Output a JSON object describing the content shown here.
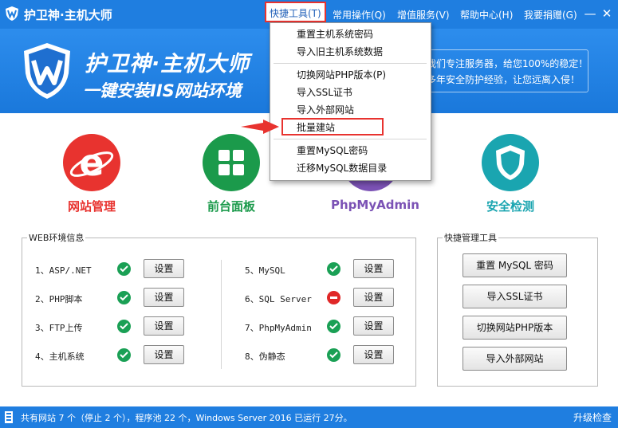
{
  "app": {
    "title": "护卫神·主机大师"
  },
  "menu": {
    "quick_tools": "快捷工具(T)",
    "common_ops": "常用操作(Q)",
    "value_added": "增值服务(V)",
    "help": "帮助中心(H)",
    "donate": "我要捐赠(G)"
  },
  "window_controls": {
    "minimize": "—",
    "close": "✕"
  },
  "banner": {
    "name": "护卫神·主机大师",
    "subtitle": "一键安装IIS网站环境",
    "slogan1": "我们专注服务器，给您100%的稳定！",
    "slogan2": "多年安全防护经验，让您远离入侵！"
  },
  "features": [
    {
      "label": "网站管理",
      "color": "#e8332f",
      "icon": "ie-icon"
    },
    {
      "label": "前台面板",
      "color": "#1b9a4b",
      "icon": "grid-icon"
    },
    {
      "label": "PhpMyAdmin",
      "color": "#7b52b5",
      "icon": "database-icon"
    },
    {
      "label": "安全检测",
      "color": "#1aa5b0",
      "icon": "shield-icon"
    }
  ],
  "env": {
    "title": "WEB环境信息",
    "items": [
      {
        "label": "1、ASP/.NET",
        "status": "ok",
        "button": "设置"
      },
      {
        "label": "2、PHP脚本",
        "status": "ok",
        "button": "设置"
      },
      {
        "label": "3、FTP上传",
        "status": "ok",
        "button": "设置"
      },
      {
        "label": "4、主机系统",
        "status": "ok",
        "button": "设置"
      },
      {
        "label": "5、MySQL",
        "status": "ok",
        "button": "设置"
      },
      {
        "label": "6、SQL Server",
        "status": "stop",
        "button": "设置"
      },
      {
        "label": "7、PhpMyAdmin",
        "status": "ok",
        "button": "设置"
      },
      {
        "label": "8、伪静态",
        "status": "ok",
        "button": "设置"
      }
    ]
  },
  "quick": {
    "title": "快捷管理工具",
    "buttons": [
      "重置 MySQL 密码",
      "导入SSL证书",
      "切换网站PHP版本",
      "导入外部网站"
    ]
  },
  "dropdown": {
    "items": [
      "重置主机系统密码",
      "导入旧主机系统数据",
      "切换网站PHP版本(P)",
      "导入SSL证书",
      "导入外部网站",
      "批量建站",
      "重置MySQL密码",
      "迁移MySQL数据目录"
    ],
    "highlighted": "批量建站"
  },
  "status": {
    "text": "共有网站 7 个（停止 2 个），程序池 22 个，Windows Server 2016 已运行 27分。",
    "upgrade": "升级检查"
  },
  "colors": {
    "brand_blue": "#1f7ee0",
    "highlight_red": "#e8332f",
    "ok_green": "#1aa055"
  }
}
